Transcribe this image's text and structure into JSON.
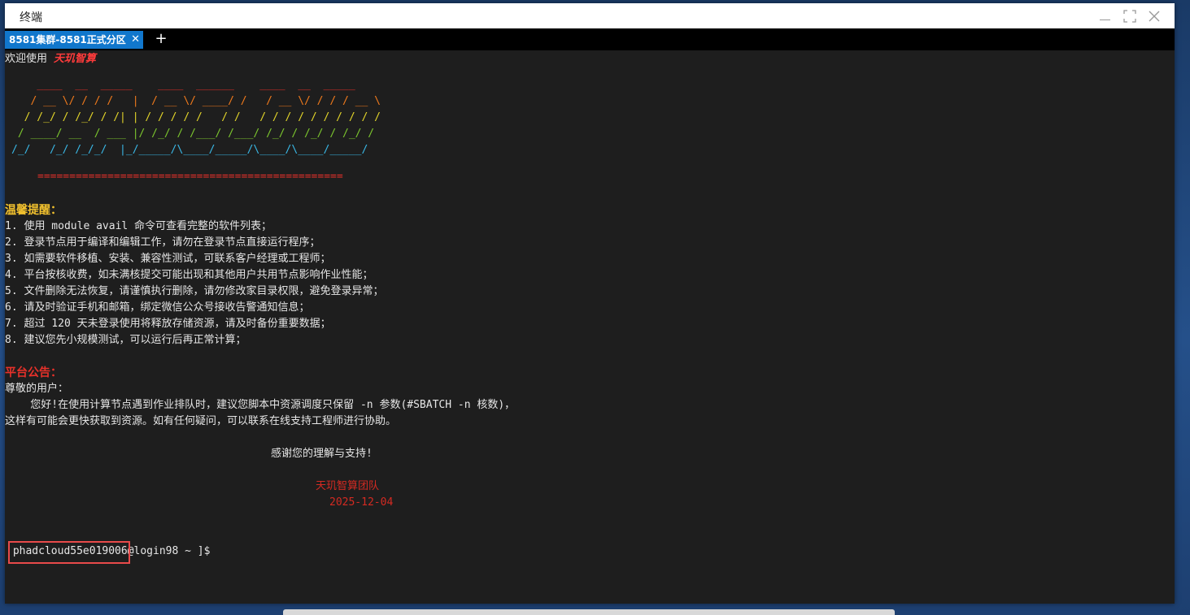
{
  "window": {
    "title": "终端",
    "controls": {
      "minimize": "minimize-icon",
      "maximize": "maximize-icon",
      "close": "close-icon"
    }
  },
  "tabs": [
    {
      "label": "8581集群-8581正式分区",
      "active": true
    }
  ],
  "tab_add_label": "+",
  "terminal": {
    "welcome_prefix": "欢迎使用 ",
    "brand": "天玑智算",
    "ascii_art": [
      "    ____  __  _____    ____  ______    ____  __  _____",
      "   / __ \\/ / / /   |  / __ \\/ ____/ /   / __ \\/ / / / __ \\",
      "  / /_/ / /_/ / /| | / / / / /   / /   / / / / / / / / / /",
      " / ____/ __  / ___ |/ /_/ / /___/ /___/ /_/ / /_/ / /_/ /",
      "/_/   /_/ /_/_/  |_/_____/\\____/_____/\\____/\\____/_____/"
    ],
    "separator": "================================================",
    "tips_heading": "温馨提醒：",
    "tips": [
      "1. 使用 module avail 命令可查看完整的软件列表；",
      "2. 登录节点用于编译和编辑工作，请勿在登录节点直接运行程序；",
      "3. 如需要软件移植、安装、兼容性测试，可联系客户经理或工程师；",
      "4. 平台按核收费，如未满核提交可能出现和其他用户共用节点影响作业性能；",
      "5. 文件删除无法恢复，请谨慎执行删除，请勿修改家目录权限，避免登录异常；",
      "6. 请及时验证手机和邮箱，绑定微信公众号接收告警通知信息；",
      "7. 超过 120 天未登录使用将释放存储资源，请及时备份重要数据；",
      "8. 建议您先小规模测试，可以运行后再正常计算；"
    ],
    "notice_heading": "平台公告：",
    "notice_greeting": "尊敬的用户：",
    "notice_line1": "    您好!在使用计算节点遇到作业排队时，建议您脚本中资源调度只保留 -n 参数(#SBATCH -n 核数)，",
    "notice_line2": "这样有可能会更快获取到资源。如有任何疑问，可以联系在线支持工程师进行协助。",
    "thanks": "感谢您的理解与支持!",
    "team": "天玑智算团队",
    "date": "2025-12-04",
    "prompt": " phadcloud55e019006@login98 ~ ]$"
  },
  "colors": {
    "tab_active": "#1177cc",
    "terminal_bg": "#1e1e1e",
    "highlight_box": "#e84a4a"
  }
}
